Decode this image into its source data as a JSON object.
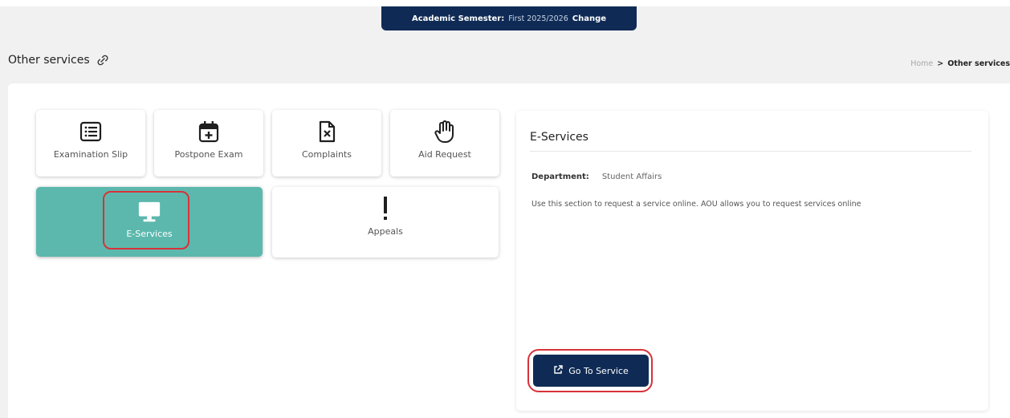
{
  "banner": {
    "label": "Academic Semester:",
    "value": "First 2025/2026",
    "change": "Change"
  },
  "page": {
    "title": "Other services",
    "title_icon": "link-icon"
  },
  "breadcrumb": {
    "home": "Home",
    "separator": ">",
    "current": "Other services"
  },
  "tiles": [
    {
      "label": "Examination Slip",
      "icon": "list-icon"
    },
    {
      "label": "Postpone Exam",
      "icon": "calendar-plus-icon"
    },
    {
      "label": "Complaints",
      "icon": "file-x-icon"
    },
    {
      "label": "Aid Request",
      "icon": "hand-icon"
    },
    {
      "label": "E-Services",
      "icon": "monitor-icon",
      "active": true
    },
    {
      "label": "Appeals",
      "icon": "exclamation-icon"
    }
  ],
  "detail": {
    "title": "E-Services",
    "department_label": "Department:",
    "department_value": "Student Affairs",
    "description": "Use this section to request a service online. AOU allows you to request services online",
    "button_label": "Go To Service",
    "button_icon": "external-link-icon"
  },
  "colors": {
    "navy": "#0f2b55",
    "teal": "#5cb8ad",
    "highlight": "#d8323a"
  }
}
